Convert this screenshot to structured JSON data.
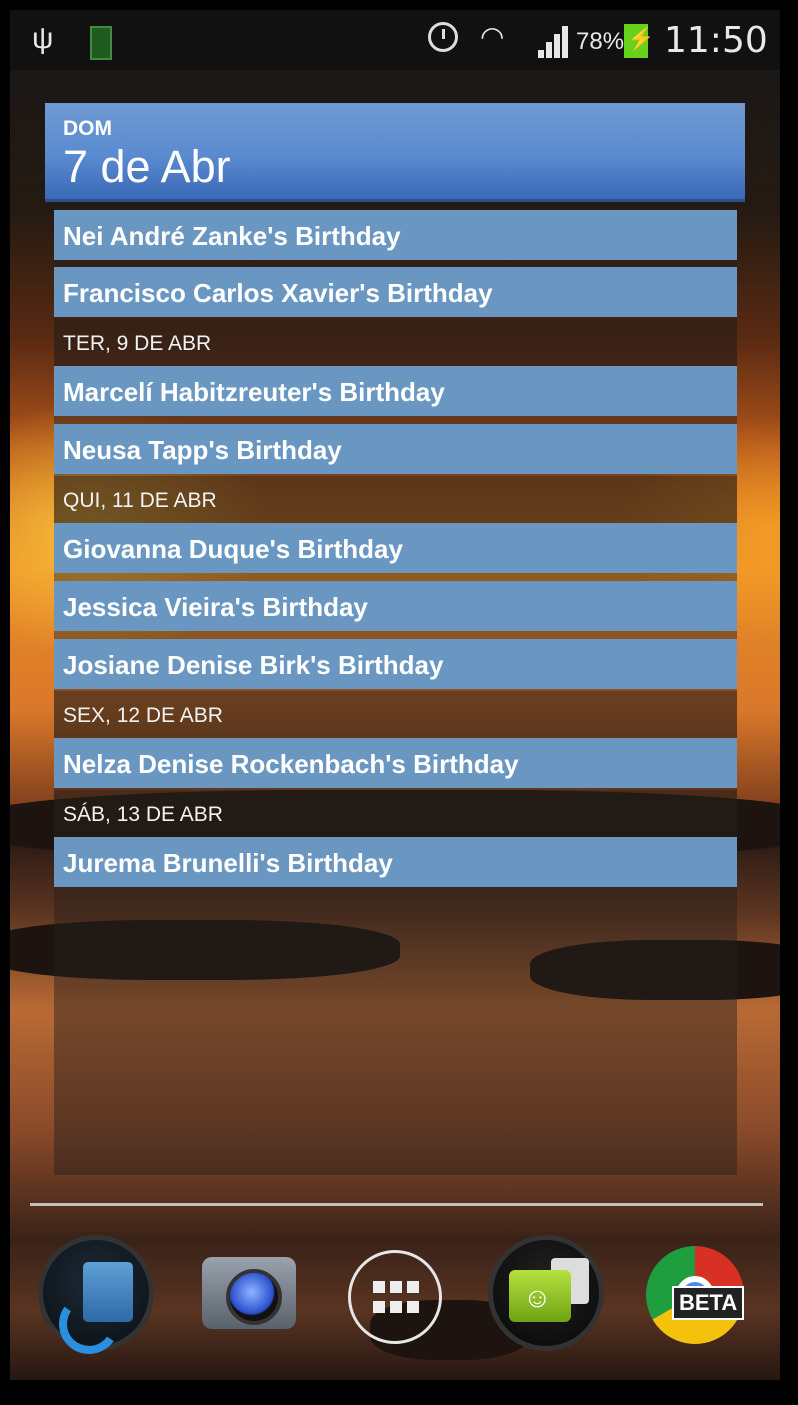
{
  "status_bar": {
    "battery_percent": "78%",
    "time": "11:50",
    "icons": [
      "usb-icon",
      "battery-small-icon",
      "alarm-icon",
      "wifi-icon",
      "signal-icon",
      "battery-charging-icon"
    ]
  },
  "widget": {
    "header": {
      "day_of_week": "DOM",
      "date": "7 de Abr"
    },
    "groups": [
      {
        "separator": "",
        "items": [
          "Nei André Zanke's Birthday",
          "Francisco Carlos Xavier's Birthday"
        ]
      },
      {
        "separator": "TER, 9 DE ABR",
        "items": [
          "Marcelí Habitzreuter's Birthday",
          "Neusa Tapp's Birthday"
        ]
      },
      {
        "separator": "QUI, 11 DE ABR",
        "items": [
          "Giovanna Duque's Birthday",
          "Jessica Vieira's Birthday",
          "Josiane Denise Birk's Birthday"
        ]
      },
      {
        "separator": "SEX, 12 DE ABR",
        "items": [
          "Nelza Denise Rockenbach's Birthday"
        ]
      },
      {
        "separator": "SÁB, 13 DE ABR",
        "items": [
          "Jurema Brunelli's Birthday"
        ]
      }
    ]
  },
  "dock": {
    "apps": [
      "phone-contacts-icon",
      "camera-icon",
      "app-drawer-icon",
      "messaging-icon",
      "chrome-beta-icon"
    ],
    "chrome_badge": "BETA"
  },
  "colors": {
    "header_blue": "#5a8ad0",
    "row_blue": "#6a97c2",
    "battery_green": "#66d21c"
  }
}
